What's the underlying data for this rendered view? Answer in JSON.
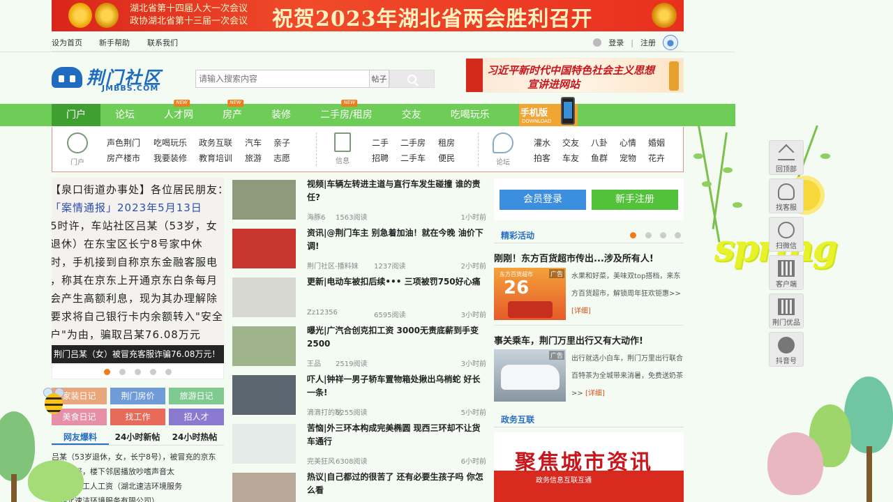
{
  "banner": {
    "line1": "湖北省第十四届人大一次会议",
    "line2": "政协湖北省第十三届一次会议",
    "headline": "祝贺2023年湖北省两会胜利召开"
  },
  "util": {
    "set_home": "设为首页",
    "help": "新手帮助",
    "contact": "联系我们",
    "login": "登录",
    "register": "注册",
    "sep": "|"
  },
  "logo": {
    "cn": "荆门社区",
    "en": "JMBBS.COM"
  },
  "search": {
    "placeholder": "请输入搜索内容",
    "category": "帖子"
  },
  "header_ad": {
    "line1": "习近平新时代中国特色社会主义思想",
    "line2": "宣讲进网站"
  },
  "nav": {
    "items": [
      {
        "label": "门户",
        "new": false
      },
      {
        "label": "论坛",
        "new": false
      },
      {
        "label": "人才网",
        "new": true
      },
      {
        "label": "房产",
        "new": true
      },
      {
        "label": "装修",
        "new": false
      },
      {
        "label": "二手房/租房",
        "new": true
      },
      {
        "label": "交友",
        "new": false
      },
      {
        "label": "吃喝玩乐",
        "new": false
      }
    ],
    "new_badge": "NEW",
    "mobile_title": "手机版",
    "mobile_sub": "DOWNLOAD"
  },
  "subnav": {
    "portal_label": "门户",
    "portal_links": [
      "声色荆门",
      "吃喝玩乐",
      "政务互联",
      "汽车",
      "亲子",
      "房产楼市",
      "我要装修",
      "教育培训",
      "旅游",
      "志愿"
    ],
    "info_label": "信息",
    "info_links": [
      "二手",
      "二手房",
      "租房",
      "招聘",
      "二手车",
      "便民"
    ],
    "forum_label": "论坛",
    "forum_links": [
      "灌水",
      "交友",
      "八卦",
      "心情",
      "婚姻",
      "拍客",
      "车友",
      "鱼群",
      "宠物",
      "花卉"
    ]
  },
  "slider": {
    "lines": [
      "【泉口街道办事处】各位居民朋友：",
      "「案情通报」2023年5月13日",
      "5时许，车站社区吕某（53岁，女",
      "退休）在东宝区长宁8号家中休",
      "时，手机接到自称京东金融客服电",
      "，称其在京东上开通京东白条每月",
      "会产生高额利息，现为其办理解除",
      "要求将自己银行卡内余额转入\"安全",
      "户\"为由，骗取吕某76.08万元"
    ],
    "caption": "荆门吕某（女）被冒充客服诈骗76.08万元！",
    "dot_count": 5,
    "active_dot": 0
  },
  "tags": [
    {
      "label": "家装日记",
      "color": "#e9a67a"
    },
    {
      "label": "荆门房价",
      "color": "#6f9bd6"
    },
    {
      "label": "旅游日记",
      "color": "#7fca8f"
    },
    {
      "label": "美食日记",
      "color": "#e88fa8"
    },
    {
      "label": "找工作",
      "color": "#e86a5a"
    },
    {
      "label": "招人才",
      "color": "#8a7ad0"
    }
  ],
  "feed_tabs": [
    "网友爆料",
    "24小时新帖",
    "24小时热帖"
  ],
  "feed_lines": [
    "吕某（53岁退休，女，长宁8号），被冒充的京东",
    "隔音不好，楼下邻居播放吵嗜声音太",
    "拖欠环卫工人工资（湖北速洁环境服务",
    "（湖北速洁环境服务有限公司）"
  ],
  "news": [
    {
      "title": "视频|车辆左转进主道与直行车发生碰撞 谁的责任?",
      "author": "海豚6",
      "views": "1563阅读",
      "time": "1小时前",
      "thumb": "#8d9a7c"
    },
    {
      "title": "资讯|@荆门车主 别急着加油！就在今晚 油价下调!",
      "author": "荆门社区-播料妹",
      "views": "1237阅读",
      "time": "2小时前",
      "thumb": "#c8372f"
    },
    {
      "title": "更新|电动车被扣后续••• 三项被罚750好心痛",
      "author": "Zz12356",
      "views": "6595阅读",
      "time": "3小时前",
      "thumb": "#d8d8d2"
    },
    {
      "title": "曝光|广汽合创克扣工资 3000无责底薪到手变2500",
      "author": "王品",
      "views": "2519阅读",
      "time": "3小时前",
      "thumb": "#9fb48a"
    },
    {
      "title": "吓人|钟祥一男子轿车置物箱处揪出乌梢蛇 好长一条!",
      "author": "滴滴打的哒",
      "views": "5255阅读",
      "time": "5小时前",
      "thumb": "#5b6670"
    },
    {
      "title": "苦恼|外三环本构成完美椭圆 现西三环却不让货车通行",
      "author": "完美狂风",
      "views": "6308阅读",
      "time": "6小时前",
      "thumb": "#e5ebe8"
    },
    {
      "title": "热议|自己都过的很苦了 还有必要生孩子吗 你怎么看",
      "author": "",
      "views": "",
      "time": "",
      "thumb": "#b7a89a"
    }
  ],
  "right": {
    "login_btn": "会员登录",
    "register_btn": "新手注册",
    "section1": "精彩活动",
    "act1_title": "刚刚！东方百货超市传出...涉及所有人!",
    "act1_text": "水果和好菜，美味双top搭档，来东方百货超市，解锁周年狂欢钜惠>>",
    "act1_more": "[详细]",
    "act1_badge": "广告",
    "act1_big": "26",
    "act2_title": "事关乘车，荆门万里出行又有大动作!",
    "act2_text": "出行就选小白车，荆门万里出行联合百特茶为全城带来消暑，免费送奶茶>>",
    "act2_more": "[详细]",
    "act2_badge": "广告",
    "section2": "政务互联",
    "gov_title": "聚焦城市资讯",
    "gov_sub": "政务信息互联互通"
  },
  "float": [
    "回顶部",
    "找客服",
    "扫微信",
    "客户端",
    "荆门优品",
    "抖音号"
  ],
  "deco_text": "spring",
  "colors": {
    "nav": "#6dcd56",
    "nav_active": "#3f9f31",
    "accent_blue": "#2a6ec4",
    "orange": "#f07b1a"
  }
}
